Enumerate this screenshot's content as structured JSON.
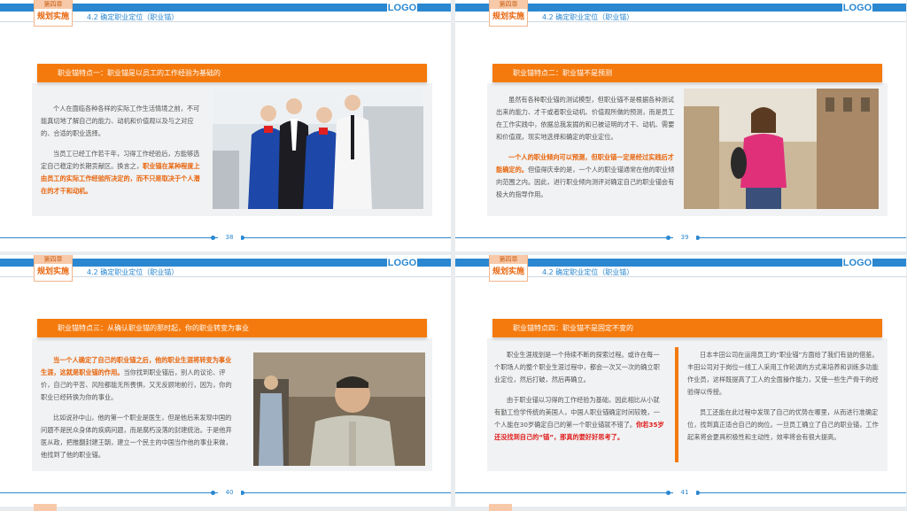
{
  "header": {
    "chapter": "第四章",
    "section": "规划实施",
    "subtitle": "4.2 确定职业定位（职业锚）",
    "logo": "LOGO"
  },
  "slides": [
    {
      "page": "38",
      "banner": "职业锚特点一：职业锚是以员工的工作经验为基础的",
      "p1": "个人在面临各种各样的实际工作生活情境之前，不可能真切地了解自己的能力、动机和价值观以及与之对应的、合适的职业选择。",
      "p2a": "当员工已经工作若干年，习得工作经验后，方能够选定自己稳定的长期贡献区。换言之，",
      "p2h": "职业锚在某种程度上由员工的实际工作经验所决定的，而不只是取决于个人潜在的才干和动机。"
    },
    {
      "page": "39",
      "banner": "职业锚特点二：职业锚不是预测",
      "p1": "虽然有各种职业锚的测试模型，但职业锚不是根据各种测试出来的能力、才干或者职业动机、价值观所做的预测，而是员工在工作实践中，依据总我发掘的和已被证明的才干、动机、需要和价值观，现实地选择和确定的职业定位。",
      "p2h": "一个人的职业倾向可以预测，但职业锚一定是经过实践后才能确定的。",
      "p2b": "但值得庆幸的是，一个人的职业锚通常在他的职业倾向范围之内。因此，进行职业倾向测评对确定自己的职业锚会有极大的指导作用。"
    },
    {
      "page": "40",
      "banner": "职业锚特点三：从确认职业锚的那时起，你的职业转变为事业",
      "p1h": "当一个人确定了自己的职业锚之后，他的职业生涯将转变为事业生涯，这就是职业锚的作用。",
      "p1b": "当你找到职业锚后，别人的议论、评价，自己的平苦、风险都能无所畏惧，又无反顾地前行，因为，你的职业已经转换为你的事业。",
      "p2": "比如说孙中山，他的第一个职业是医生，但是他后来发现中国的问题不是民众身体的疾病问题，而是腐朽没落的封建统治。于是他弃医从政，把推翻封建王朝，建立一个民主的中国当作他的事业来做，他找到了他的职业锚。"
    },
    {
      "page": "41",
      "banner": "职业锚特点四：职业锚不是固定不变的",
      "l1": "职业生涯规划是一个持续不断的探索过程。或许在每一个职场人的整个职业生涯过程中，都会一次又一次的确立职业定位，然后打破，然后再确立。",
      "l2a": "由于职业锚以习得的工作经验为基础，因此相比从小就有勤工俭学传统的美国人，中国人职业锚确定时间较晚，一个人能在30岁确定自己的第一个职业锚就不错了。",
      "l2r": "你若35岁还没找到自己的“锚”，那真的要好好思考了。",
      "r1": "日本丰田公司在运用员工的“职业锚”方面给了我们有益的借鉴。丰田公司对于岗位一线工人采用工作轮调的方式来培养和训练多功能作业员，这样既提高了工人的全面操作能力，又使一些生产骨干的经验得以传授。",
      "r2": "员工还能在此过程中发现了自己的优势在哪里，从而进行准确定位，找到真正适合自己的岗位。一旦员工确立了自己的职业锚，工作起来将会更具积极性和主动性，效率将会有很大提高。"
    }
  ]
}
